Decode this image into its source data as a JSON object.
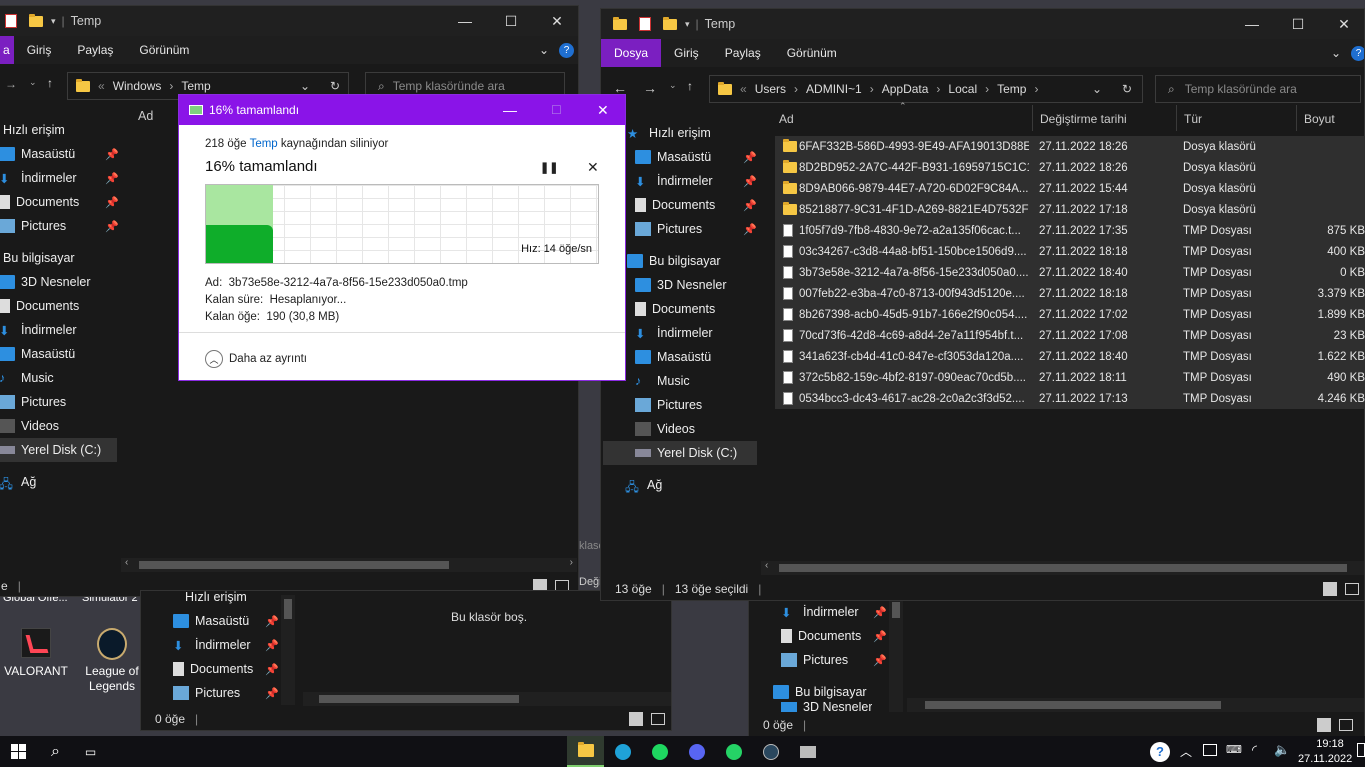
{
  "desktop": {
    "icons": [
      {
        "label": "VALORANT"
      },
      {
        "label": "League of\nLegends"
      }
    ],
    "partial_labels": [
      "Global Offe...",
      "Simulator 2"
    ]
  },
  "left_window": {
    "title": "Temp",
    "tabs": [
      "a",
      "Giriş",
      "Paylaş",
      "Görünüm"
    ],
    "address": [
      "Windows",
      "Temp"
    ],
    "search_placeholder": "Temp klasöründe ara",
    "column_name": "Ad",
    "nav": [
      {
        "label": "Hızlı erişim"
      },
      {
        "label": "Masaüstü"
      },
      {
        "label": "İndirmeler"
      },
      {
        "label": "Documents"
      },
      {
        "label": "Pictures"
      },
      {
        "label": "Bu bilgisayar"
      },
      {
        "label": "3D Nesneler"
      },
      {
        "label": "Documents"
      },
      {
        "label": "İndirmeler"
      },
      {
        "label": "Masaüstü"
      },
      {
        "label": "Music"
      },
      {
        "label": "Pictures"
      },
      {
        "label": "Videos"
      },
      {
        "label": "Yerel Disk (C:)"
      },
      {
        "label": "Ağ"
      }
    ],
    "status": "e",
    "peek_text": "klasö",
    "peek_text2": "Deği"
  },
  "right_window": {
    "title": "Temp",
    "tabs": [
      "Dosya",
      "Giriş",
      "Paylaş",
      "Görünüm"
    ],
    "address": [
      "Users",
      "ADMINI~1",
      "AppData",
      "Local",
      "Temp"
    ],
    "search_placeholder": "Temp klasöründe ara",
    "columns": {
      "name": "Ad",
      "date": "Değiştirme tarihi",
      "type": "Tür",
      "size": "Boyut"
    },
    "nav": [
      {
        "label": "Hızlı erişim"
      },
      {
        "label": "Masaüstü"
      },
      {
        "label": "İndirmeler"
      },
      {
        "label": "Documents"
      },
      {
        "label": "Pictures"
      },
      {
        "label": "Bu bilgisayar"
      },
      {
        "label": "3D Nesneler"
      },
      {
        "label": "Documents"
      },
      {
        "label": "İndirmeler"
      },
      {
        "label": "Masaüstü"
      },
      {
        "label": "Music"
      },
      {
        "label": "Pictures"
      },
      {
        "label": "Videos"
      },
      {
        "label": "Yerel Disk (C:)"
      },
      {
        "label": "Ağ"
      }
    ],
    "files": [
      {
        "name": "6FAF332B-586D-4993-9E49-AFA19013D88E",
        "date": "27.11.2022 18:26",
        "type": "Dosya klasörü",
        "size": "",
        "kind": "folder"
      },
      {
        "name": "8D2BD952-2A7C-442F-B931-16959715C1C1",
        "date": "27.11.2022 18:26",
        "type": "Dosya klasörü",
        "size": "",
        "kind": "folder"
      },
      {
        "name": "8D9AB066-9879-44E7-A720-6D02F9C84A...",
        "date": "27.11.2022 15:44",
        "type": "Dosya klasörü",
        "size": "",
        "kind": "folder"
      },
      {
        "name": "85218877-9C31-4F1D-A269-8821E4D7532F",
        "date": "27.11.2022 17:18",
        "type": "Dosya klasörü",
        "size": "",
        "kind": "folder"
      },
      {
        "name": "1f05f7d9-7fb8-4830-9e72-a2a135f06cac.t...",
        "date": "27.11.2022 17:35",
        "type": "TMP Dosyası",
        "size": "875 KB",
        "kind": "file"
      },
      {
        "name": "03c34267-c3d8-44a8-bf51-150bce1506d9....",
        "date": "27.11.2022 18:18",
        "type": "TMP Dosyası",
        "size": "400 KB",
        "kind": "file"
      },
      {
        "name": "3b73e58e-3212-4a7a-8f56-15e233d050a0....",
        "date": "27.11.2022 18:40",
        "type": "TMP Dosyası",
        "size": "0 KB",
        "kind": "file"
      },
      {
        "name": "007feb22-e3ba-47c0-8713-00f943d5120e....",
        "date": "27.11.2022 18:18",
        "type": "TMP Dosyası",
        "size": "3.379 KB",
        "kind": "file"
      },
      {
        "name": "8b267398-acb0-45d5-91b7-166e2f90c054....",
        "date": "27.11.2022 17:02",
        "type": "TMP Dosyası",
        "size": "1.899 KB",
        "kind": "file"
      },
      {
        "name": "70cd73f6-42d8-4c69-a8d4-2e7a11f954bf.t...",
        "date": "27.11.2022 17:08",
        "type": "TMP Dosyası",
        "size": "23 KB",
        "kind": "file"
      },
      {
        "name": "341a623f-cb4d-41c0-847e-cf3053da120a....",
        "date": "27.11.2022 18:40",
        "type": "TMP Dosyası",
        "size": "1.622 KB",
        "kind": "file"
      },
      {
        "name": "372c5b82-159c-4bf2-8197-090eac70cd5b....",
        "date": "27.11.2022 18:11",
        "type": "TMP Dosyası",
        "size": "490 KB",
        "kind": "file"
      },
      {
        "name": "0534bcc3-dc43-4617-ac28-2c0a2c3f3d52....",
        "date": "27.11.2022 17:13",
        "type": "TMP Dosyası",
        "size": "4.246 KB",
        "kind": "file"
      }
    ],
    "status_count": "13 öğe",
    "status_selected": "13 öğe seçildi"
  },
  "bottom_left_window": {
    "nav": [
      {
        "label": "Hızlı erişim"
      },
      {
        "label": "Masaüstü"
      },
      {
        "label": "İndirmeler"
      },
      {
        "label": "Documents"
      },
      {
        "label": "Pictures"
      }
    ],
    "empty_message": "Bu klasör boş.",
    "status": "0 öğe"
  },
  "bottom_right_window": {
    "nav": [
      {
        "label": "İndirmeler"
      },
      {
        "label": "Documents"
      },
      {
        "label": "Pictures"
      },
      {
        "label": "Bu bilgisayar"
      },
      {
        "label": "3D Nesneler"
      }
    ],
    "status": "0 öğe"
  },
  "delete_dialog": {
    "title": "16%  tamamlandı",
    "source_prefix": "218 öğe",
    "source_link": "Temp",
    "source_suffix": "kaynağından siliniyor",
    "heading": "16%  tamamlandı",
    "speed": "Hız: 14 öğe/sn",
    "progress_fraction": 0.16,
    "details": [
      {
        "label": "Ad:",
        "value": "3b73e58e-3212-4a7a-8f56-15e233d050a0.tmp"
      },
      {
        "label": "Kalan süre:",
        "value": "Hesaplanıyor..."
      },
      {
        "label": "Kalan öğe:",
        "value": "190 (30,8 MB)"
      }
    ],
    "less_details": "Daha az ayrıntı"
  },
  "taskbar": {
    "time": "19:18",
    "date": "27.11.2022",
    "apps": [
      "start-icon",
      "search-icon",
      "task-view-icon",
      "file-explorer-icon",
      "edge-icon",
      "spotify-icon",
      "discord-icon",
      "whatsapp-icon",
      "steam-icon",
      "network-monitor-icon"
    ]
  },
  "colors": {
    "accent": "#8a14e8",
    "ribbon_active": "#7b1fc1",
    "progress_green": "#0fad2a"
  }
}
